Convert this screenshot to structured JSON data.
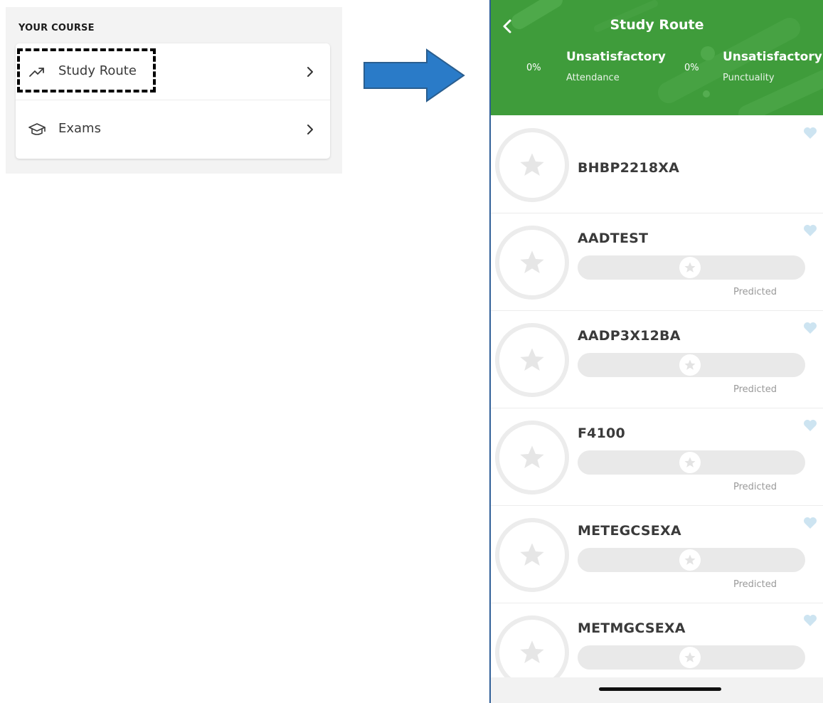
{
  "left_panel": {
    "section_heading": "YOUR COURSE",
    "menu": [
      {
        "label": "Study Route",
        "icon": "trend-icon"
      },
      {
        "label": "Exams",
        "icon": "graduation-cap-icon"
      }
    ]
  },
  "phone": {
    "header": {
      "title": "Study Route",
      "background_color": "#3f9c3b",
      "stats": [
        {
          "percent": "0%",
          "status": "Unsatisfactory",
          "caption": "Attendance"
        },
        {
          "percent": "0%",
          "status": "Unsatisfactory",
          "caption": "Punctuality"
        }
      ]
    },
    "courses": [
      {
        "code": "BHBP2218XA",
        "has_progress": false,
        "predicted_label": ""
      },
      {
        "code": "AADTEST",
        "has_progress": true,
        "predicted_label": "Predicted"
      },
      {
        "code": "AADP3X12BA",
        "has_progress": true,
        "predicted_label": "Predicted"
      },
      {
        "code": "F4100",
        "has_progress": true,
        "predicted_label": "Predicted"
      },
      {
        "code": "METEGCSEXA",
        "has_progress": true,
        "predicted_label": "Predicted"
      },
      {
        "code": "METMGCSEXA",
        "has_progress": true,
        "predicted_label": "Predicted"
      }
    ],
    "heart_color": "#cde4f1"
  },
  "colors": {
    "arrow_fill": "#2a7bc8",
    "arrow_stroke": "#2a5e8f",
    "highlight_border": "#000000"
  }
}
